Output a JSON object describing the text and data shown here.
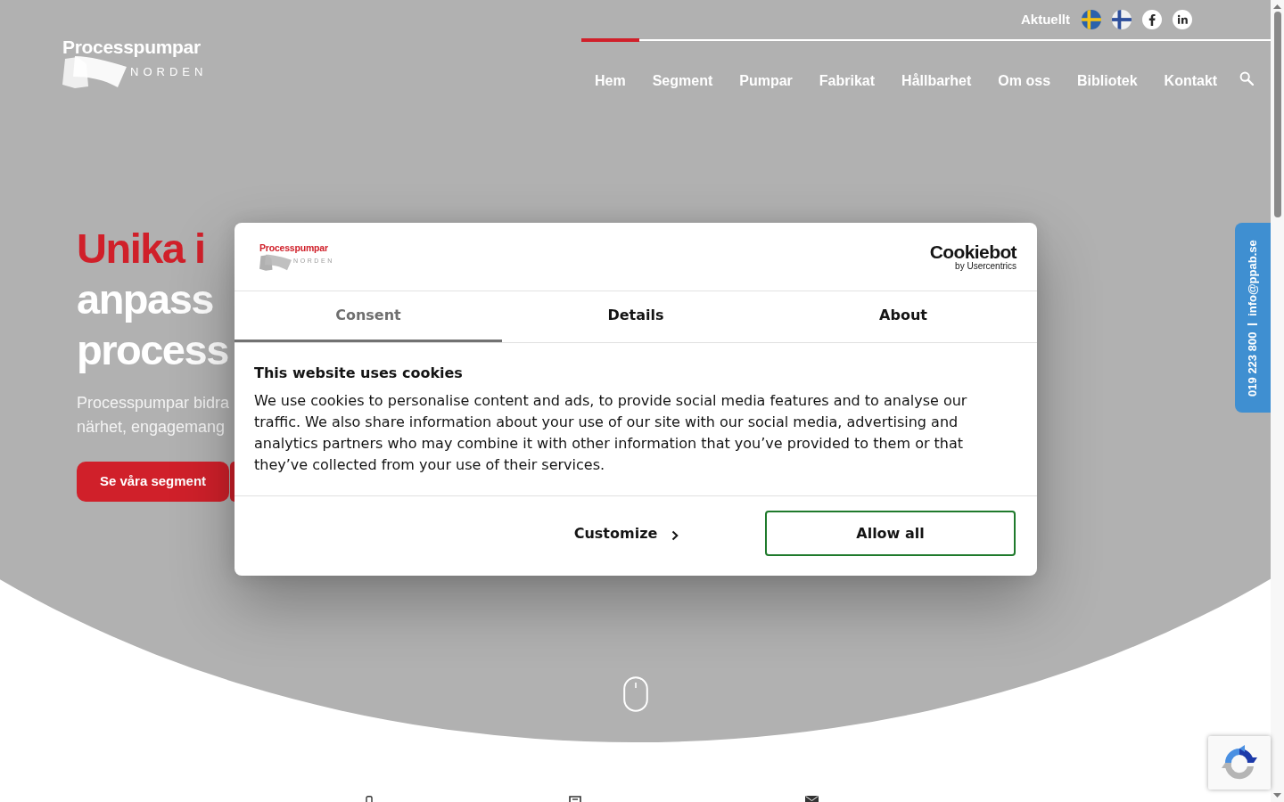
{
  "header": {
    "logo": {
      "name": "Processpumpar",
      "tagline": "NORDEN"
    },
    "top_link": "Aktuellt",
    "nav": [
      {
        "label": "Hem",
        "selected": true
      },
      {
        "label": "Segment",
        "selected": false
      },
      {
        "label": "Pumpar",
        "selected": false
      },
      {
        "label": "Fabrikat",
        "selected": false
      },
      {
        "label": "Hållbarhet",
        "selected": false
      },
      {
        "label": "Om oss",
        "selected": false
      },
      {
        "label": "Bibliotek",
        "selected": false
      },
      {
        "label": "Kontakt",
        "selected": false
      }
    ]
  },
  "hero": {
    "title": [
      {
        "text": "Unika i",
        "accent": true
      },
      {
        "text": "anpass",
        "accent": false
      },
      {
        "text": "process",
        "accent": false
      }
    ],
    "lead": [
      "Processpumpar bidra",
      "närhet, engagemang"
    ],
    "button": "Se våra segment"
  },
  "contact_tab": {
    "phone": "019 223 800",
    "email": "info@ppab.se"
  },
  "cookie_dialog": {
    "logo": {
      "name": "Processpumpar",
      "tagline": "NORDEN"
    },
    "brand": {
      "name": "Cookiebot",
      "tagline": "by Usercentrics"
    },
    "tabs": [
      {
        "label": "Consent",
        "selected": true
      },
      {
        "label": "Details",
        "selected": false
      },
      {
        "label": "About",
        "selected": false
      }
    ],
    "heading": "This website uses cookies",
    "body": "We use cookies to personalise content and ads, to provide social media features and to analyse our traffic. We also share information about your use of our site with our social media, advertising and analytics partners who may combine it with other information that you’ve provided to them or that they’ve collected from your use of their services.",
    "buttons": [
      {
        "label": "Customize",
        "kind": "link"
      },
      {
        "label": "Allow all",
        "kind": "outline"
      }
    ]
  }
}
